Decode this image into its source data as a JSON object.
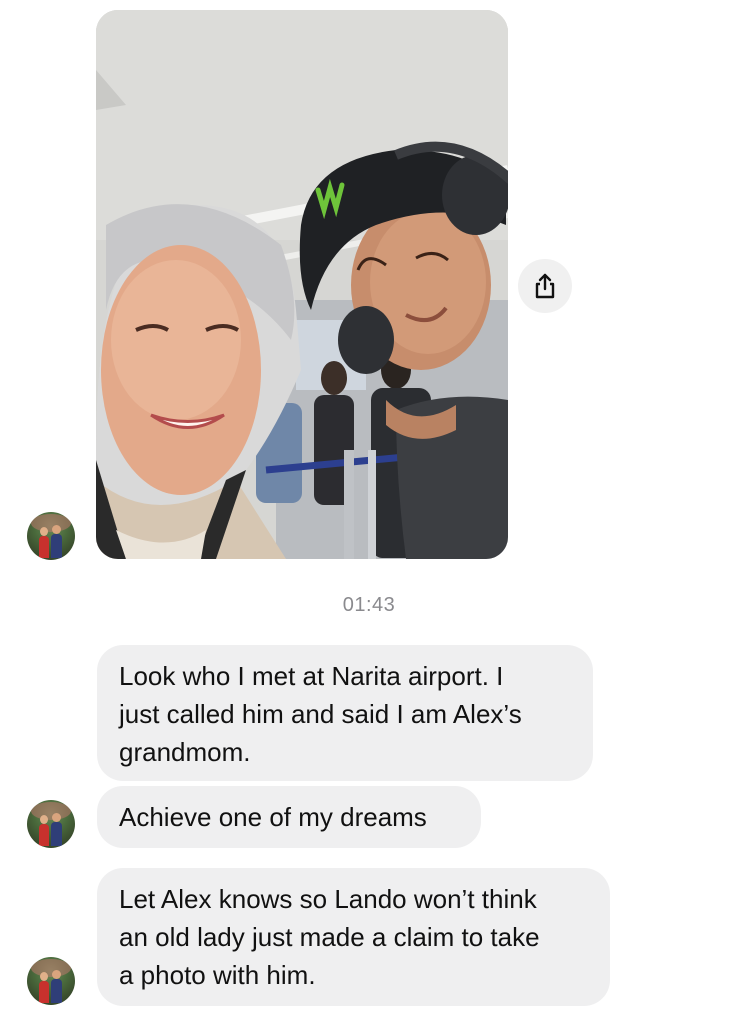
{
  "thread": {
    "timestamp": "01:43",
    "messages": [
      {
        "text": "Look who I met at Narita airport. I\njust called him and said I am Alex’s\ngrandmom."
      },
      {
        "text": "Achieve one of my dreams"
      },
      {
        "text": "Let Alex knows so Lando won’t think\nan old lady just made a claim to take\na photo with him."
      }
    ]
  },
  "icons": {
    "share": "share-icon",
    "avatar": "sender-avatar"
  },
  "colors": {
    "bubble_bg": "#efeff0",
    "timestamp": "#8a8a8e",
    "share_bg": "#f0f0f0"
  }
}
